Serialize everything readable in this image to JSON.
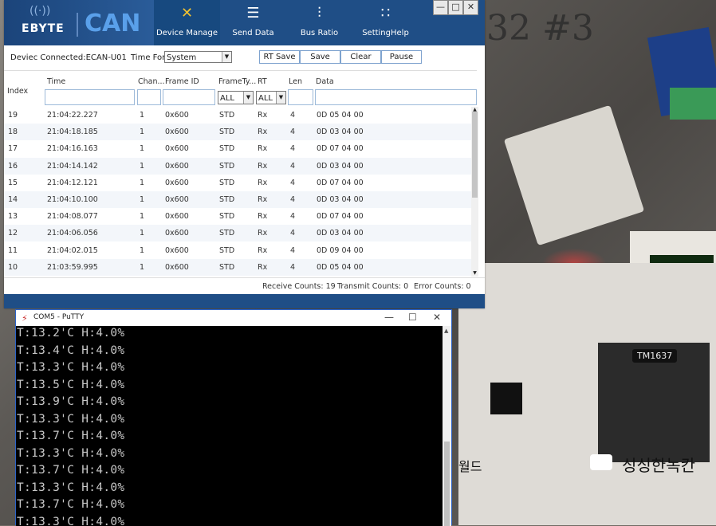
{
  "ecan": {
    "logo_brand": "EBYTE",
    "logo_product": "CAN",
    "toolbar": [
      {
        "label": "Device Manage",
        "icon": "tools-icon"
      },
      {
        "label": "Send Data",
        "icon": "sliders-icon"
      },
      {
        "label": "Bus Ratio",
        "icon": "equalizer-icon"
      },
      {
        "label": "SettingHelp",
        "icon": "grid-icon"
      }
    ],
    "window_controls": {
      "minimize": "—",
      "restore": "□",
      "close": "✕"
    },
    "device_connected": "Deviec Connected:ECAN-U01",
    "time_format_label": "Time Format:",
    "time_format_value": "System",
    "buttons": {
      "rt_save": "RT Save",
      "save": "Save",
      "clear": "Clear",
      "pause": "Pause"
    },
    "columns": {
      "index": "Index",
      "time": "Time",
      "channel": "Chan...",
      "frame_id": "Frame ID",
      "frame_type": "FrameTy...",
      "rt": "RT",
      "len": "Len",
      "data": "Data"
    },
    "filter_frame_type": "ALL",
    "filter_rt": "ALL",
    "rows": [
      {
        "index": "19",
        "time": "21:04:22.227",
        "chan": "1",
        "frame_id": "0x600",
        "type": "STD",
        "rt": "Rx",
        "len": "4",
        "data": "0D 05 04 00"
      },
      {
        "index": "18",
        "time": "21:04:18.185",
        "chan": "1",
        "frame_id": "0x600",
        "type": "STD",
        "rt": "Rx",
        "len": "4",
        "data": "0D 03 04 00"
      },
      {
        "index": "17",
        "time": "21:04:16.163",
        "chan": "1",
        "frame_id": "0x600",
        "type": "STD",
        "rt": "Rx",
        "len": "4",
        "data": "0D 07 04 00"
      },
      {
        "index": "16",
        "time": "21:04:14.142",
        "chan": "1",
        "frame_id": "0x600",
        "type": "STD",
        "rt": "Rx",
        "len": "4",
        "data": "0D 03 04 00"
      },
      {
        "index": "15",
        "time": "21:04:12.121",
        "chan": "1",
        "frame_id": "0x600",
        "type": "STD",
        "rt": "Rx",
        "len": "4",
        "data": "0D 07 04 00"
      },
      {
        "index": "14",
        "time": "21:04:10.100",
        "chan": "1",
        "frame_id": "0x600",
        "type": "STD",
        "rt": "Rx",
        "len": "4",
        "data": "0D 03 04 00"
      },
      {
        "index": "13",
        "time": "21:04:08.077",
        "chan": "1",
        "frame_id": "0x600",
        "type": "STD",
        "rt": "Rx",
        "len": "4",
        "data": "0D 07 04 00"
      },
      {
        "index": "12",
        "time": "21:04:06.056",
        "chan": "1",
        "frame_id": "0x600",
        "type": "STD",
        "rt": "Rx",
        "len": "4",
        "data": "0D 03 04 00"
      },
      {
        "index": "11",
        "time": "21:04:02.015",
        "chan": "1",
        "frame_id": "0x600",
        "type": "STD",
        "rt": "Rx",
        "len": "4",
        "data": "0D 09 04 00"
      },
      {
        "index": "10",
        "time": "21:03:59.995",
        "chan": "1",
        "frame_id": "0x600",
        "type": "STD",
        "rt": "Rx",
        "len": "4",
        "data": "0D 05 04 00"
      }
    ],
    "receive_counts": "Receive Counts:  19",
    "transmit_counts": "Transmit Counts:  0",
    "error_counts": "Error Counts:  0"
  },
  "putty": {
    "title": "COM5 - PuTTY",
    "controls": {
      "minimize": "—",
      "maximize": "☐",
      "close": "✕"
    },
    "lines": [
      "T:13.2'C H:4.0%",
      "T:13.4'C H:4.0%",
      "T:13.3'C H:4.0%",
      "T:13.5'C H:4.0%",
      "T:13.9'C H:4.0%",
      "T:13.3'C H:4.0%",
      "T:13.7'C H:4.0%",
      "T:13.3'C H:4.0%",
      "T:13.7'C H:4.0%",
      "T:13.3'C H:4.0%",
      "T:13.7'C H:4.0%",
      "T:13.3'C H:4.0%"
    ]
  },
  "photo": {
    "scribble": "32 #3",
    "board_chip_label": "TM1637",
    "korean_text": "싱싱한녹칸",
    "korean_text2": "월드"
  },
  "colors": {
    "toolbar_bg": "#1f4e86",
    "accent_blue": "#5aa0ea",
    "terminal_bg": "#000000",
    "terminal_fg": "#c8c8c8"
  }
}
